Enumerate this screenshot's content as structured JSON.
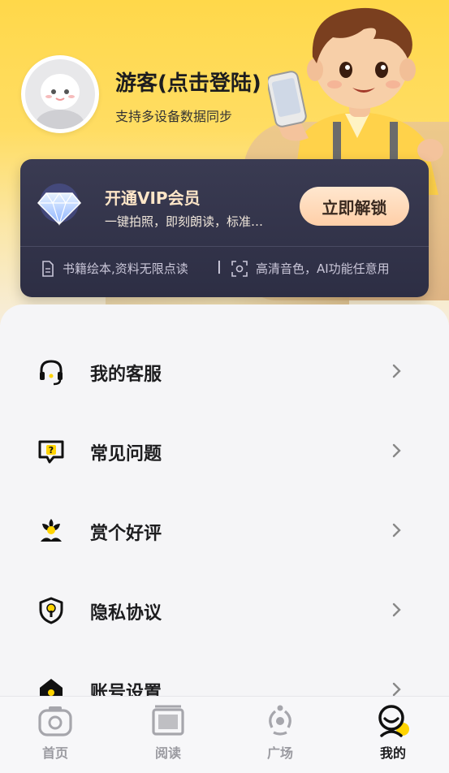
{
  "profile": {
    "name": "游客(点击登陆)",
    "subtitle": "支持多设备数据同步"
  },
  "vip": {
    "title": "开通VIP会员",
    "description": "一键拍照，即刻朗读，标准…",
    "button_label": "立即解锁",
    "feature_1": "书籍绘本,资料无限点读",
    "separator": "|",
    "feature_2": "高清音色，AI功能任意用"
  },
  "menu": {
    "items": [
      {
        "label": "我的客服",
        "icon": "headset-icon"
      },
      {
        "label": "常见问题",
        "icon": "question-chat-icon"
      },
      {
        "label": "赏个好评",
        "icon": "flower-icon"
      },
      {
        "label": "隐私协议",
        "icon": "shield-lock-icon"
      },
      {
        "label": "账号设置",
        "icon": "house-icon"
      }
    ]
  },
  "tabbar": {
    "tabs": [
      {
        "label": "首页",
        "icon": "camera-icon",
        "active": false
      },
      {
        "label": "阅读",
        "icon": "book-icon",
        "active": false
      },
      {
        "label": "广场",
        "icon": "share-icon",
        "active": false
      },
      {
        "label": "我的",
        "icon": "profile-icon",
        "active": true
      }
    ]
  },
  "colors": {
    "header_yellow": "#ffd84a",
    "vip_card": "#2d2e44",
    "vip_button": "#ffcfa8",
    "accent_yellow": "#ffd400",
    "text_dark": "#1d1d1f"
  }
}
